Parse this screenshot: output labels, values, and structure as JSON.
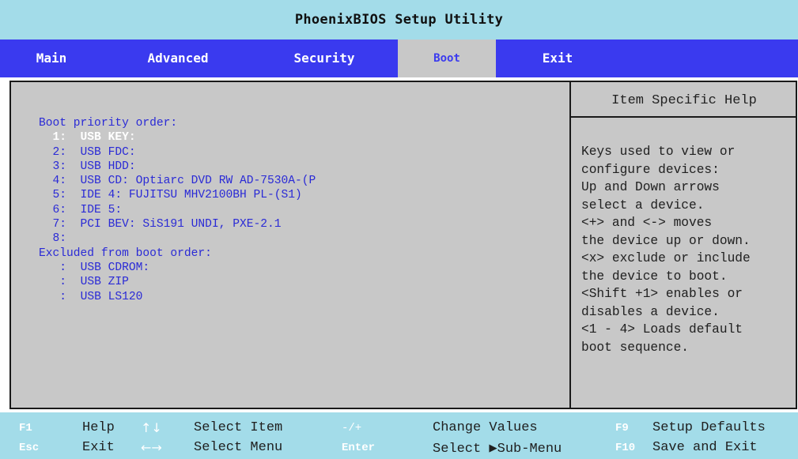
{
  "title": "PhoenixBIOS Setup Utility",
  "menu": {
    "tabs": [
      {
        "label": "Main"
      },
      {
        "label": "Advanced"
      },
      {
        "label": "Security"
      },
      {
        "label": "Boot"
      },
      {
        "label": "Exit"
      }
    ],
    "active": "Boot"
  },
  "boot": {
    "priority_heading": "Boot priority order:",
    "priority": [
      {
        "num": "1:",
        "label": "USB KEY:"
      },
      {
        "num": "2:",
        "label": "USB FDC:"
      },
      {
        "num": "3:",
        "label": "USB HDD:"
      },
      {
        "num": "4:",
        "label": "USB CD: Optiarc DVD RW AD-7530A-(P"
      },
      {
        "num": "5:",
        "label": "IDE 4: FUJITSU MHV2100BH PL-(S1)"
      },
      {
        "num": "6:",
        "label": "IDE 5:"
      },
      {
        "num": "7:",
        "label": "PCI BEV: SiS191 UNDI, PXE-2.1"
      },
      {
        "num": "8:",
        "label": ""
      }
    ],
    "excluded_heading": "Excluded from boot order:",
    "excluded": [
      {
        "num": ":",
        "label": "USB CDROM:"
      },
      {
        "num": ":",
        "label": "USB ZIP"
      },
      {
        "num": ":",
        "label": "USB LS120"
      }
    ]
  },
  "help": {
    "title": "Item Specific Help",
    "lines": [
      "Keys used to view or",
      "configure devices:",
      "Up and Down arrows",
      "select a device.",
      "<+> and <-> moves",
      "the device up or down.",
      "<x> exclude or include",
      "the device to boot.",
      "<Shift +1> enables or",
      "disables a device.",
      "<1 - 4> Loads default",
      "boot sequence."
    ]
  },
  "footer": {
    "row1": {
      "key1": "F1",
      "label1": "Help",
      "arrow1": "↑↓",
      "label2": "Select Item",
      "key2": "-/+",
      "label3": "Change Values",
      "key3": "F9",
      "label4": "Setup Defaults"
    },
    "row2": {
      "key1": "Esc",
      "label1": "Exit",
      "arrow1": "←→",
      "label2": "Select Menu",
      "key2": "Enter",
      "label3": "Select ▶Sub-Menu",
      "key3": "F10",
      "label4": "Save and Exit"
    }
  },
  "colors": {
    "title_bar": "#a3dce9",
    "menu_bar": "#3a3aef",
    "panel": "#c8c8c8",
    "item_text": "#2a2ad6",
    "selected_text": "#ffffff"
  }
}
